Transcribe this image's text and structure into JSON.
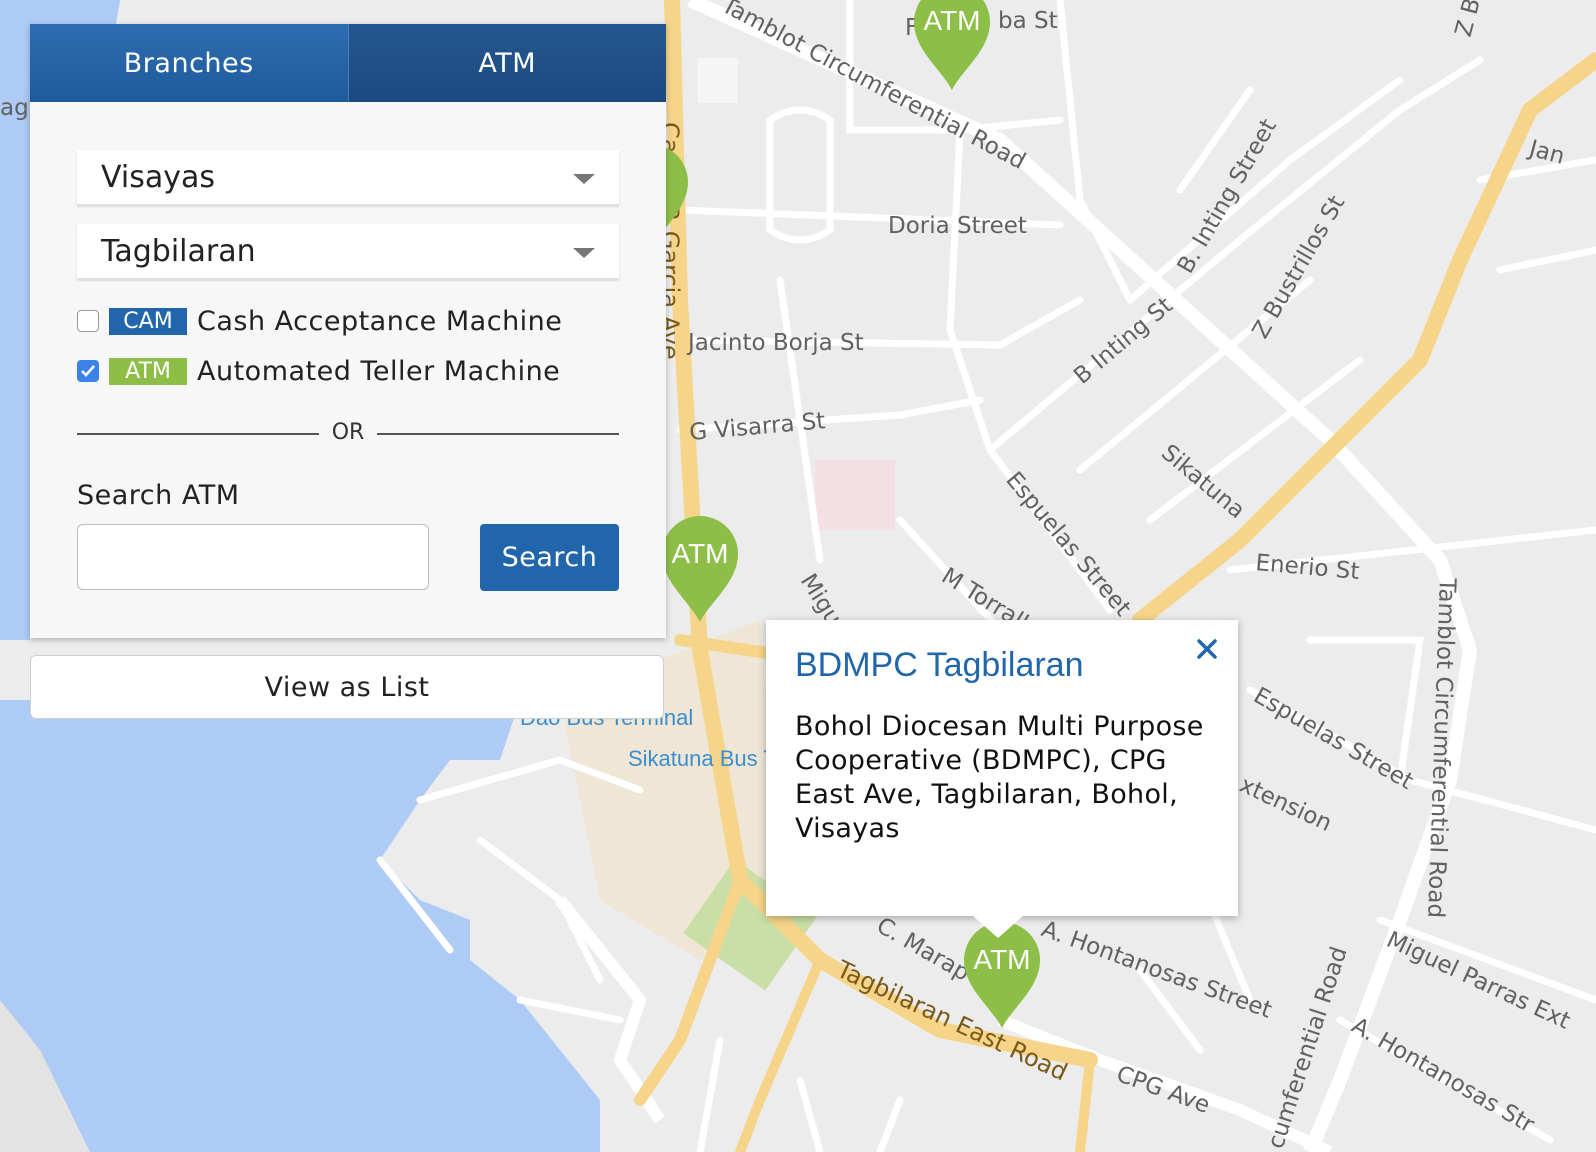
{
  "map": {
    "street_labels": [
      "Tamblot Circumferential Road",
      "Doria Street",
      "Jacinto Borja St",
      "G Visarra St",
      "B. Inting Street",
      "Z Bustrillos St",
      "B Inting St",
      "Sikatuna",
      "Espuelas Street",
      "Enerio St",
      "M Torralba St",
      "Miguel Parras Ext",
      "A. Hontanosas Street",
      "Tagbilaran East Road",
      "CPG Ave",
      "Carlos P. Garcia Ave",
      "Jan",
      "Z Bu",
      "agbi",
      "ba St",
      "F",
      "C. Marap",
      "Migue",
      "Espuelas Street",
      "xtension",
      "Tamblot Circumferential Road",
      "cumferential Road",
      "A. Hontanosas Str"
    ],
    "poi_labels": [
      "Dao Bus Terminal",
      "Sikatuna Bus T"
    ],
    "marker_label": "ATM",
    "colors": {
      "water": "#aecbf5",
      "land": "#ececec",
      "road": "#ffffff",
      "arterial": "#f6d58a",
      "marker": "#8dbf48",
      "park": "#c9dfa6"
    }
  },
  "panel": {
    "tabs": [
      {
        "label": "Branches",
        "active": true
      },
      {
        "label": "ATM",
        "active": false
      }
    ],
    "region_select": "Visayas",
    "city_select": "Tagbilaran",
    "filters": [
      {
        "badge": "CAM",
        "badge_color": "#2166ab",
        "label": "Cash Acceptance Machine",
        "checked": false
      },
      {
        "badge": "ATM",
        "badge_color": "#8dbf48",
        "label": "Automated Teller Machine",
        "checked": true
      }
    ],
    "or_text": "OR",
    "search_label": "Search ATM",
    "search_value": "",
    "search_button": "Search",
    "view_list": "View as List"
  },
  "info_window": {
    "title": "BDMPC Tagbilaran",
    "address": "Bohol Diocesan Multi Purpose Cooperative (BDMPC), CPG East Ave, Tagbilaran, Bohol, Visayas",
    "close_icon": "close-icon"
  }
}
